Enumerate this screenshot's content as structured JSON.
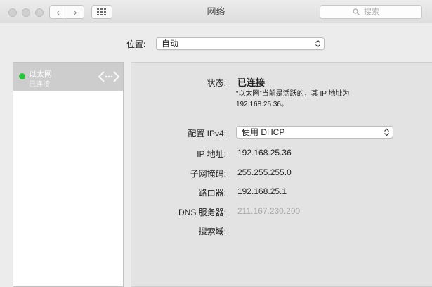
{
  "window": {
    "title": "网络"
  },
  "toolbar": {
    "back_glyph": "‹",
    "forward_glyph": "›",
    "search_placeholder": "搜索"
  },
  "location": {
    "label": "位置:",
    "value": "自动"
  },
  "services": [
    {
      "name": "以太网",
      "status": "已连接",
      "status_color": "#29c13b"
    }
  ],
  "detail": {
    "status_label": "状态:",
    "status_value": "已连接",
    "status_note_line1": "“以太网”当前是活跃的，其 IP 地址为",
    "status_note_line2": "192.168.25.36。",
    "config_label": "配置 IPv4:",
    "config_value": "使用 DHCP",
    "ip_label": "IP 地址:",
    "ip_value": "192.168.25.36",
    "subnet_label": "子网掩码:",
    "subnet_value": "255.255.255.0",
    "router_label": "路由器:",
    "router_value": "192.168.25.1",
    "dns_label": "DNS 服务器:",
    "dns_value": "211.167.230.200",
    "search_domain_label": "搜索域:"
  },
  "icons": {
    "traffic": [
      "close-icon",
      "minimize-icon",
      "zoom-icon"
    ],
    "grid": "grid-icon",
    "search": "search-icon",
    "ethernet": "ethernet-icon"
  }
}
